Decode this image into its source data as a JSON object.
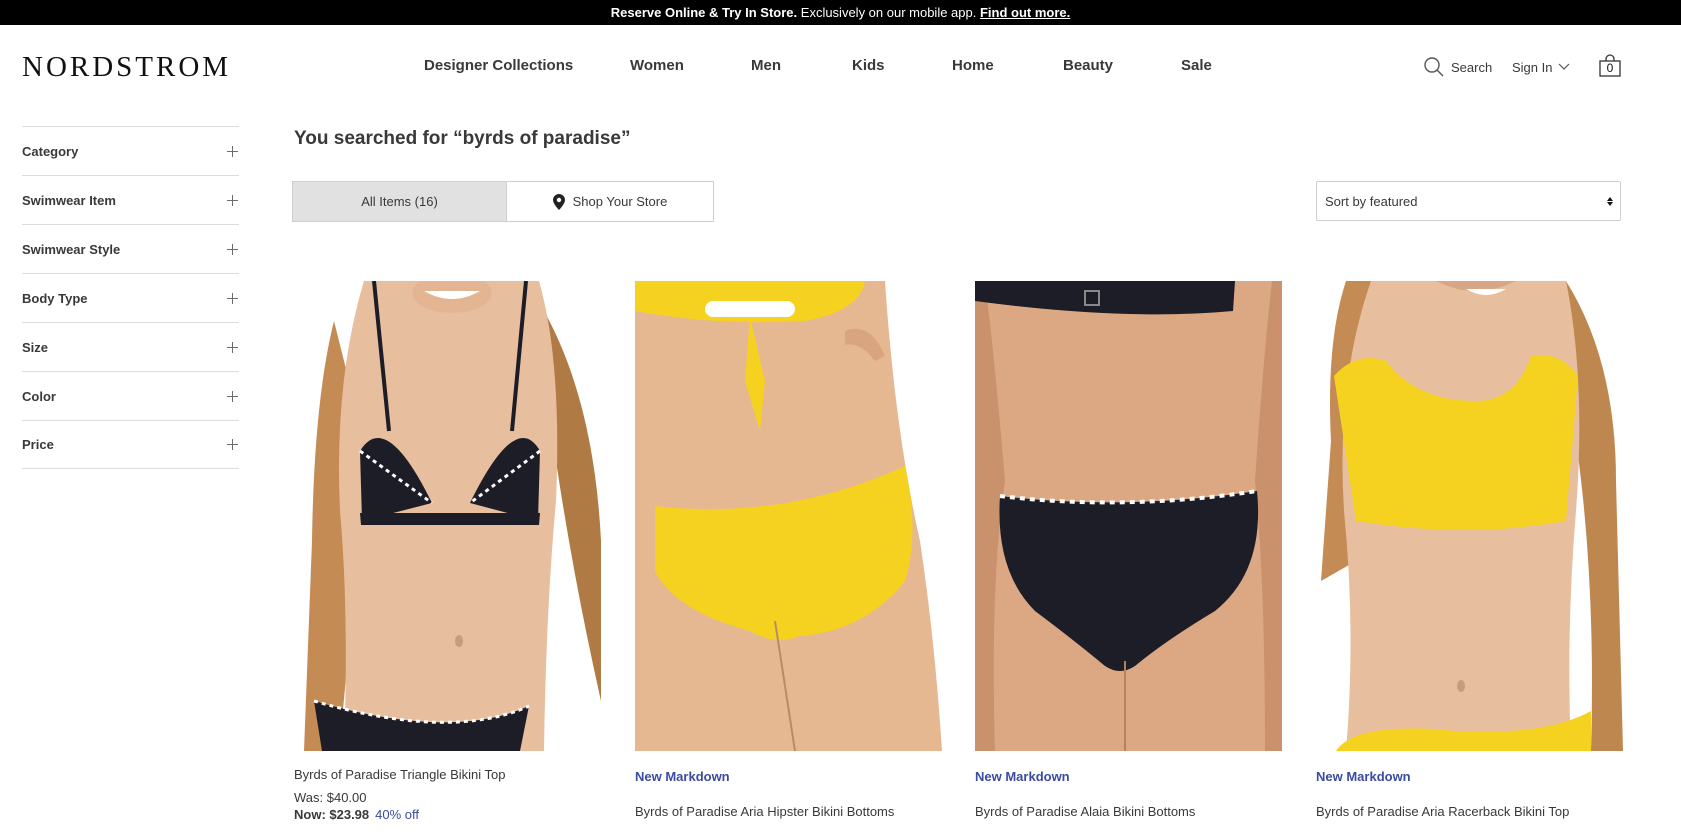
{
  "promo": {
    "bold": "Reserve Online & Try In Store.",
    "text": " Exclusively on our mobile app. ",
    "link": "Find out more."
  },
  "header": {
    "logo": "NORDSTROM",
    "nav": [
      "Designer Collections",
      "Women",
      "Men",
      "Kids",
      "Home",
      "Beauty",
      "Sale"
    ],
    "search_label": "Search",
    "sign_in_label": "Sign In",
    "bag_count": "0"
  },
  "sidebar": {
    "facets": [
      "Category",
      "Swimwear Item",
      "Swimwear Style",
      "Body Type",
      "Size",
      "Color",
      "Price"
    ]
  },
  "results": {
    "title": "You searched for “byrds of paradise”",
    "tab_all": "All Items (16)",
    "tab_store": "Shop Your Store",
    "sort": "Sort by featured"
  },
  "products": [
    {
      "badge": "",
      "name": "Byrds of Paradise Triangle Bikini Top",
      "was_price": "Was: $40.00",
      "now_label": "Now: $23.98",
      "discount": "40% off",
      "swatch": "#1a1c24"
    },
    {
      "badge": "New Markdown",
      "name": "Byrds of Paradise Aria Hipster Bikini Bottoms",
      "swatch": "#f4d21f"
    },
    {
      "badge": "New Markdown",
      "name": "Byrds of Paradise Alaia Bikini Bottoms",
      "swatch": "#1a1c24"
    },
    {
      "badge": "New Markdown",
      "name": "Byrds of Paradise Aria Racerback Bikini Top",
      "swatch": "#f4d21f"
    }
  ],
  "colors": {
    "accent": "#3b4c9f",
    "promo_bg": "#000000",
    "tab_active_bg": "#e1e1e1"
  }
}
